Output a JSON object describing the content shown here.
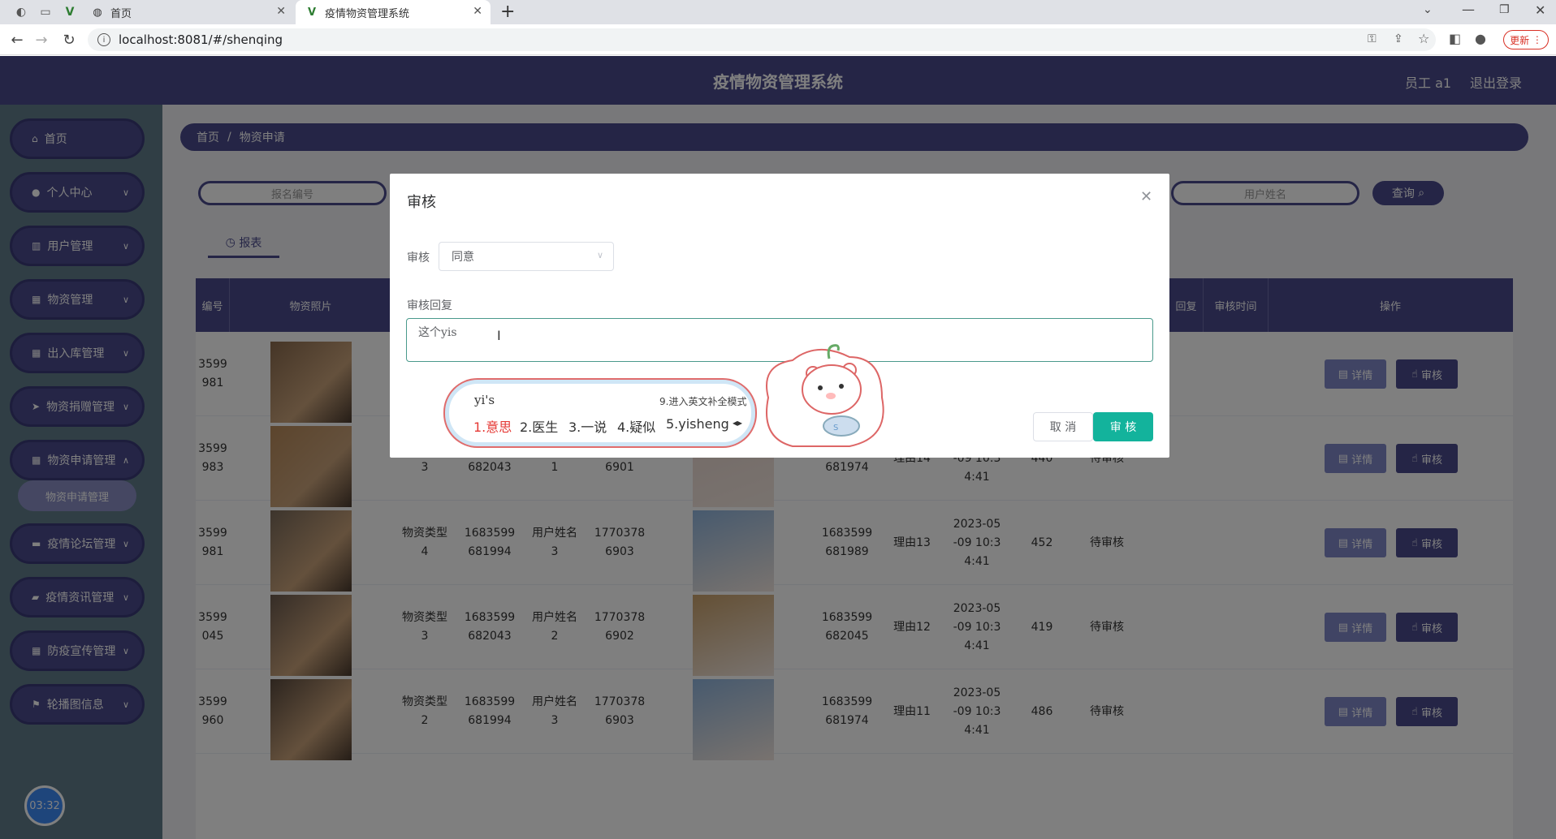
{
  "browser": {
    "tabs": [
      {
        "label": "首页"
      },
      {
        "label": "疫情物资管理系统"
      }
    ],
    "new_tab": "+",
    "url": "localhost:8081/#/shenqing",
    "update_label": "更新"
  },
  "app": {
    "title": "疫情物资管理系统",
    "user": "员工 a1",
    "logout": "退出登录",
    "sidebar": [
      {
        "label": "首页",
        "icon": "home-icon"
      },
      {
        "label": "个人中心",
        "icon": "user-icon"
      },
      {
        "label": "用户管理",
        "icon": "chart-icon"
      },
      {
        "label": "物资管理",
        "icon": "grid-icon"
      },
      {
        "label": "出入库管理",
        "icon": "grid-icon"
      },
      {
        "label": "物资捐赠管理",
        "icon": "send-icon"
      },
      {
        "label": "物资申请管理",
        "icon": "grid-icon"
      },
      {
        "label": "疫情论坛管理",
        "icon": "doc-icon"
      },
      {
        "label": "疫情资讯管理",
        "icon": "news-icon"
      },
      {
        "label": "防疫宣传管理",
        "icon": "grid-icon"
      },
      {
        "label": "轮播图信息",
        "icon": "flag-icon"
      }
    ],
    "submenu_active": "物资申请管理",
    "clock": "03:32",
    "breadcrumb": {
      "home": "首页",
      "sep": "/",
      "current": "物资申请"
    },
    "search": {
      "placeholder1": "报名编号",
      "placeholder2": "用户姓名",
      "query": "查询"
    },
    "report_tab": "报表",
    "table": {
      "headers": [
        "编号",
        "物资照片",
        "回复",
        "审核时间",
        "操作"
      ],
      "rows": [
        {
          "id": "3599\n981",
          "type": "",
          "code": "",
          "name": "",
          "phone": "",
          "reqno": "",
          "reason": "",
          "time": "",
          "qty": "",
          "status": ""
        },
        {
          "id": "3599\n983",
          "type": "物资类型\n3",
          "code": "1683599\n682043",
          "name": "用户姓名\n1",
          "phone": "1770378\n6901",
          "reqno": "1683599\n681974",
          "reason": "理由14",
          "time": "2023-05\n-09 10:3\n4:41",
          "qty": "440",
          "status": "待审核"
        },
        {
          "id": "3599\n981",
          "type": "物资类型\n4",
          "code": "1683599\n681994",
          "name": "用户姓名\n3",
          "phone": "1770378\n6903",
          "reqno": "1683599\n681989",
          "reason": "理由13",
          "time": "2023-05\n-09 10:3\n4:41",
          "qty": "452",
          "status": "待审核"
        },
        {
          "id": "3599\n045",
          "type": "物资类型\n3",
          "code": "1683599\n682043",
          "name": "用户姓名\n2",
          "phone": "1770378\n6902",
          "reqno": "1683599\n682045",
          "reason": "理由12",
          "time": "2023-05\n-09 10:3\n4:41",
          "qty": "419",
          "status": "待审核"
        },
        {
          "id": "3599\n960",
          "type": "物资类型\n2",
          "code": "1683599\n681994",
          "name": "用户姓名\n3",
          "phone": "1770378\n6903",
          "reqno": "1683599\n681974",
          "reason": "理由11",
          "time": "2023-05\n-09 10:3\n4:41",
          "qty": "486",
          "status": "待审核"
        }
      ],
      "detail_label": "详情",
      "audit_label": "审核"
    }
  },
  "dialog": {
    "title": "审核",
    "field1_label": "审核",
    "field1_value": "同意",
    "field2_label": "审核回复",
    "field2_value": "这个yis",
    "cancel": "取 消",
    "confirm": "审 核"
  },
  "ime": {
    "input": "yi's",
    "tip": "9.进入英文补全模式",
    "candidates": [
      "1.意思",
      "2.医生",
      "3.一说",
      "4.疑似",
      "5.yisheng"
    ]
  },
  "colors": {
    "primary": "#4a4a8c",
    "confirm": "#13b39c",
    "sidebar": "#607d8b"
  }
}
